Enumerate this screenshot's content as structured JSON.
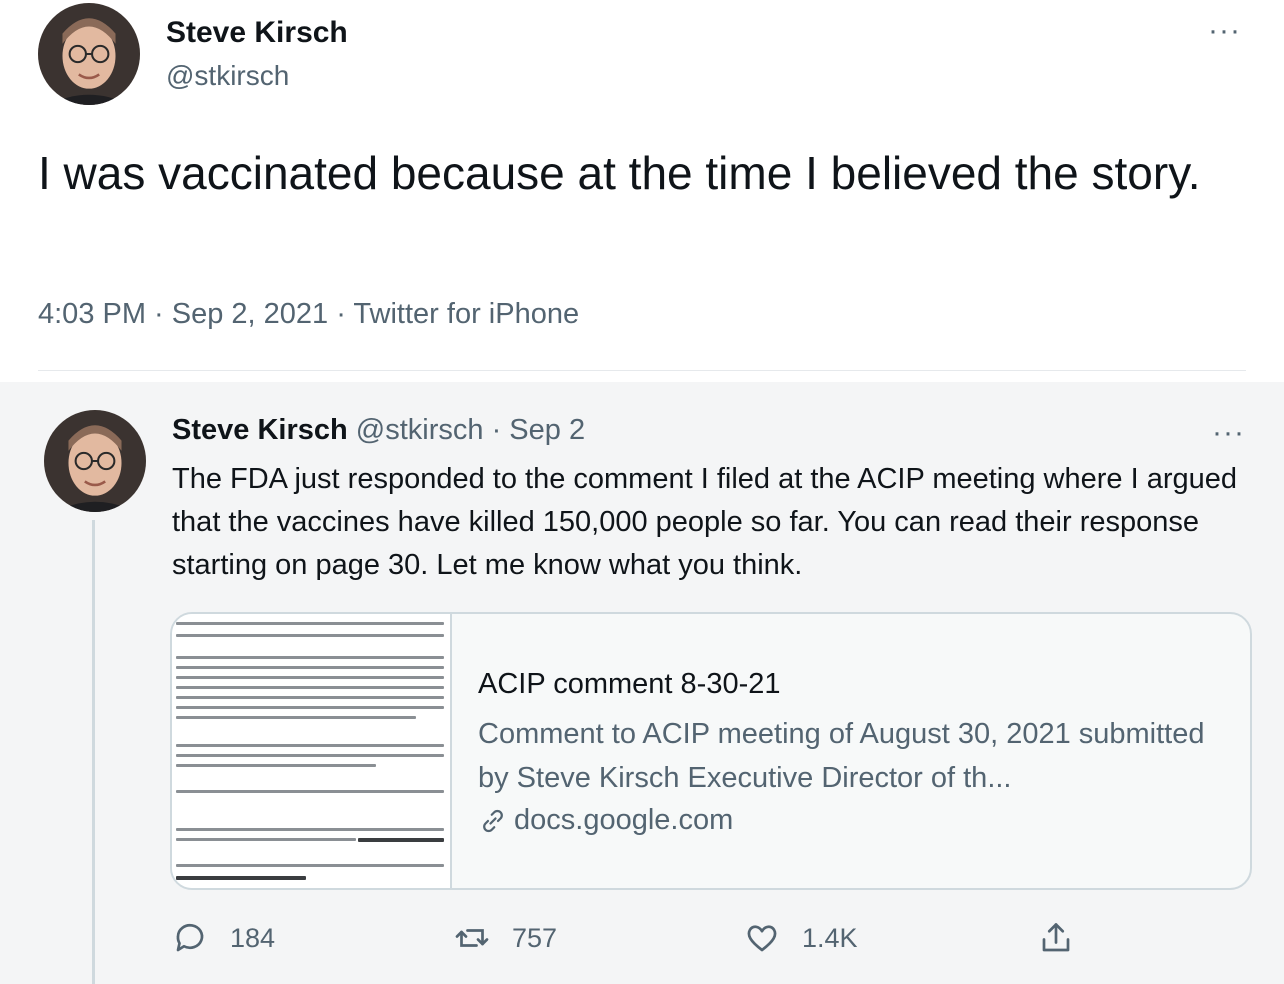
{
  "main_tweet": {
    "name": "Steve Kirsch",
    "handle": "@stkirsch",
    "more": "···",
    "text": "I was vaccinated because at the time I believed the story.",
    "meta": "4:03 PM · Sep 2, 2021 · Twitter for iPhone"
  },
  "reply_tweet": {
    "name": "Steve Kirsch",
    "handle": "@stkirsch",
    "separator": "·",
    "date": "Sep 2",
    "more": "···",
    "text": "The FDA just responded to the comment I filed at the ACIP meeting where I argued that the vaccines have killed 150,000 people so far. You can read their response starting on page 30. Let me know what you think.",
    "card": {
      "title": "ACIP comment 8-30-21",
      "description": "Comment to ACIP meeting of August 30, 2021 submitted by Steve Kirsch Executive Director of th...",
      "domain": "docs.google.com"
    },
    "actions": {
      "replies": "184",
      "retweets": "757",
      "likes": "1.4K"
    }
  },
  "colors": {
    "text_primary": "#0f1419",
    "text_secondary": "#536471",
    "panel_bg": "#f4f5f6",
    "border": "#cfd9de"
  }
}
